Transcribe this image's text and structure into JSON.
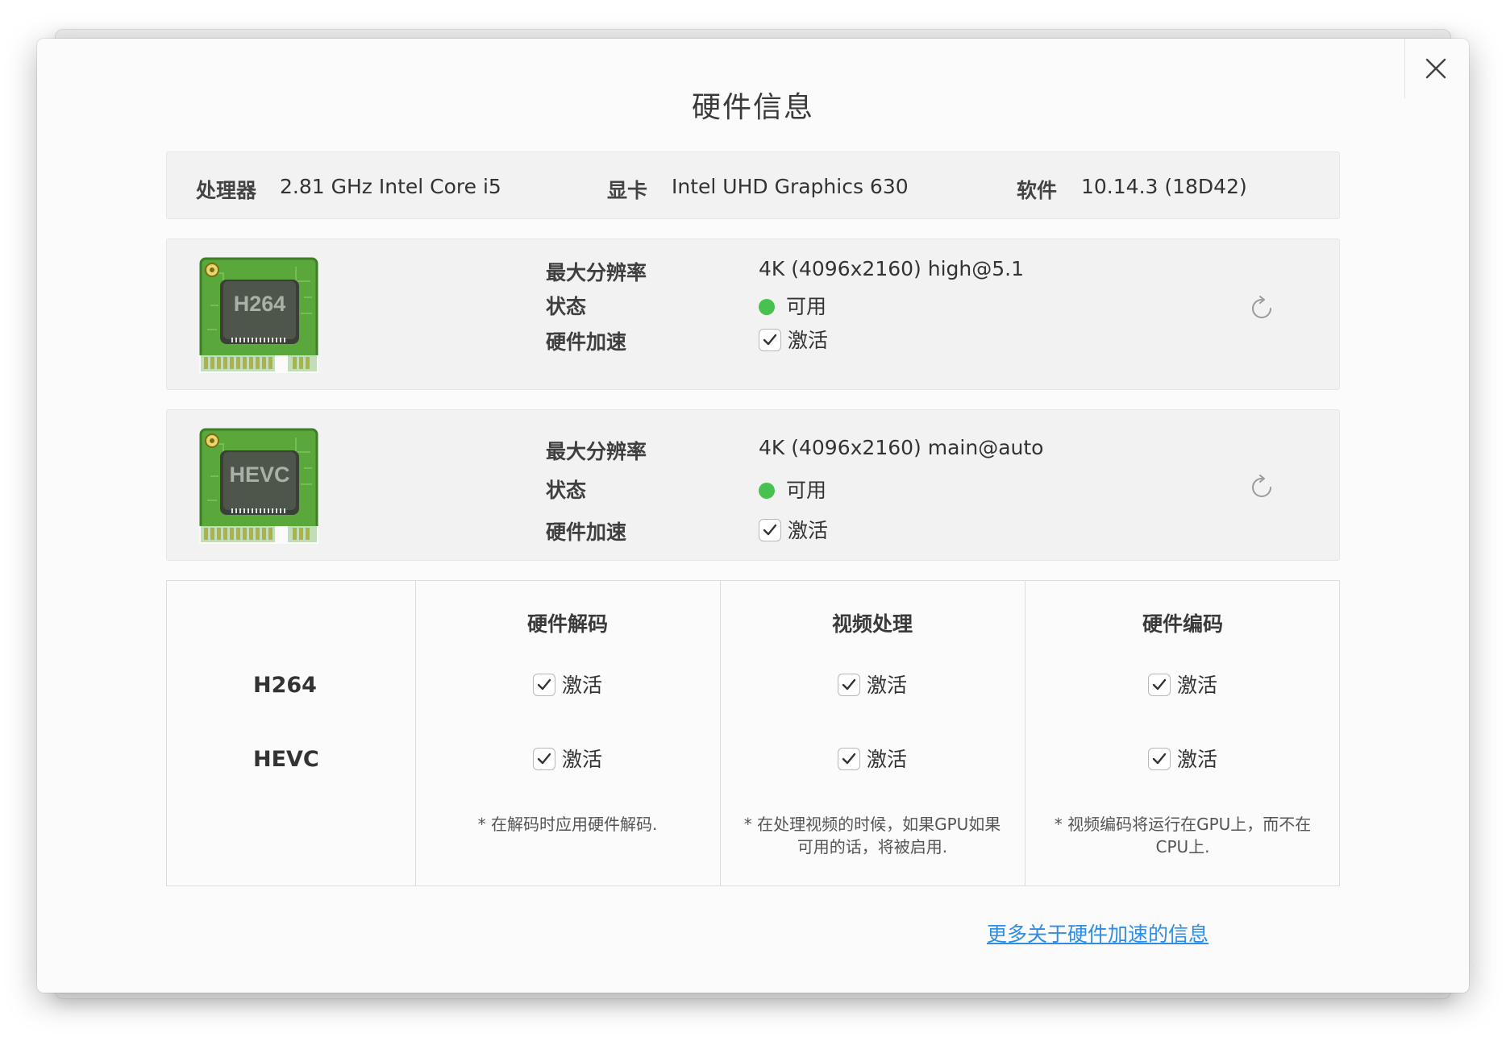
{
  "dialog": {
    "title": "硬件信息",
    "close_icon": "close-icon"
  },
  "info_bar": {
    "processor_label": "处理器",
    "processor_value": "2.81 GHz Intel Core i5",
    "gpu_label": "显卡",
    "gpu_value": "Intel UHD Graphics 630",
    "software_label": "软件",
    "software_value": "10.14.3 (18D42)"
  },
  "codecs": [
    {
      "chip_text": "H264",
      "max_res_label": "最大分辨率",
      "max_res_value": "4K (4096x2160) high@5.1",
      "status_label": "状态",
      "status_value": "可用",
      "accel_label": "硬件加速",
      "accel_value": "激活",
      "accel_checked": true
    },
    {
      "chip_text": "HEVC",
      "max_res_label": "最大分辨率",
      "max_res_value": "4K (4096x2160) main@auto",
      "status_label": "状态",
      "status_value": "可用",
      "accel_label": "硬件加速",
      "accel_value": "激活",
      "accel_checked": true
    }
  ],
  "table": {
    "headers": [
      "硬件解码",
      "视频处理",
      "硬件编码"
    ],
    "rows": [
      {
        "name": "H264",
        "cells": [
          "激活",
          "激活",
          "激活"
        ]
      },
      {
        "name": "HEVC",
        "cells": [
          "激活",
          "激活",
          "激活"
        ]
      }
    ],
    "notes": [
      "* 在解码时应用硬件解码.",
      "* 在处理视频的时候，如果GPU如果可用的话，将被启用.",
      "* 视频编码将运行在GPU上，而不在CPU上."
    ]
  },
  "more_link": "更多关于硬件加速的信息",
  "colors": {
    "accent_link": "#2f8de4",
    "status_available": "#48c24f",
    "chip_green": "#5aa83c"
  }
}
